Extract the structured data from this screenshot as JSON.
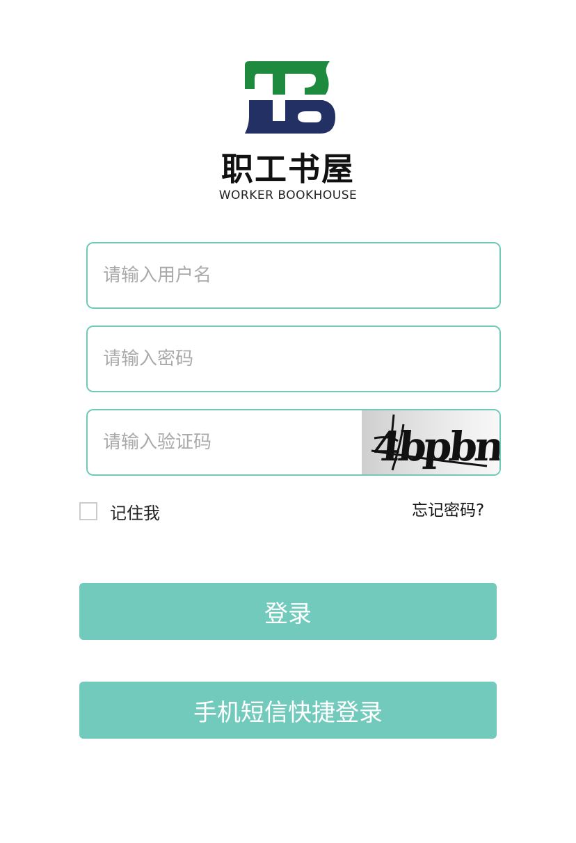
{
  "brand": {
    "name_cn": "职工书屋",
    "name_en": "WORKER BOOKHOUSE",
    "logo_colors": {
      "top": "#1e8a3e",
      "bottom": "#233064"
    }
  },
  "form": {
    "username_placeholder": "请输入用户名",
    "password_placeholder": "请输入密码",
    "captcha_placeholder": "请输入验证码",
    "captcha_text": "4bpbn",
    "remember_label": "记住我",
    "forgot_label": "忘记密码?"
  },
  "buttons": {
    "login_label": "登录",
    "sms_login_label": "手机短信快捷登录"
  },
  "colors": {
    "accent": "#72cabd",
    "border": "#6fcab9",
    "placeholder": "#aaaaaa"
  }
}
